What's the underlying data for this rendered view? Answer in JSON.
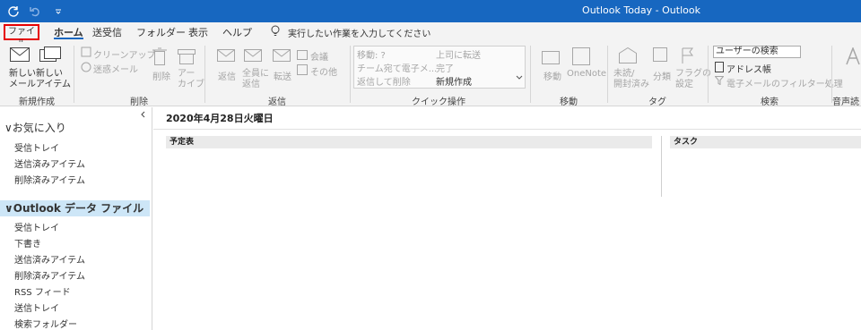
{
  "window": {
    "title": "Outlook Today  -  Outlook"
  },
  "quick_access": [
    "sync-icon",
    "undo-icon",
    "customize-icon"
  ],
  "menu": {
    "tabs": [
      "ファイル",
      "ホーム",
      "送受信",
      "フォルダー",
      "表示",
      "ヘルプ"
    ],
    "tell_me": "実行したい作業を入力してください",
    "active_tab": "ホーム",
    "highlight_color": "#e60000"
  },
  "ribbon": {
    "new_group": {
      "label": "新規作成",
      "new_mail": "新しい\nメール",
      "new_items": "新しい\nアイテム"
    },
    "delete_group": {
      "label": "削除",
      "cleanup": "クリーンアップ",
      "junk": "迷惑メール",
      "delete": "削除",
      "archive": "アー\nカイブ"
    },
    "respond_group": {
      "label": "返信",
      "reply": "返信",
      "reply_all": "全員に\n返信",
      "forward": "転送",
      "meeting": "会議",
      "more": "その他"
    },
    "quick_steps": {
      "label": "クイック操作",
      "items": [
        "移動: ?",
        "チーム宛て電子メ...",
        "返信して削除",
        "上司に転送",
        "完了",
        "新規作成"
      ]
    },
    "move_group": {
      "label": "移動",
      "move": "移動",
      "onenote": "OneNote"
    },
    "tags_group": {
      "label": "タグ",
      "unread": "未読/\n開封済み",
      "categorize": "分類",
      "flag": "フラグの\n設定"
    },
    "find_group": {
      "label": "検索",
      "search_placeholder": "ユーザーの検索",
      "address_book": "アドレス帳",
      "filter": "電子メールのフィルター処理"
    },
    "speech_group": {
      "label": "音声読"
    }
  },
  "nav": {
    "favorites": {
      "label": "お気に入り",
      "items": [
        "受信トレイ",
        "送信済みアイテム",
        "削除済みアイテム"
      ]
    },
    "data_file": {
      "label": "Outlook データ ファイル",
      "items": [
        "受信トレイ",
        "下書き",
        "送信済みアイテム",
        "削除済みアイテム",
        "RSS フィード",
        "送信トレイ",
        "検索フォルダー"
      ]
    }
  },
  "main": {
    "date": "2020年4月28日火曜日",
    "calendar_header": "予定表",
    "tasks_header": "タスク"
  },
  "colors": {
    "title_bar": "#1767c0",
    "ribbon_bg": "#f3f3f3",
    "nav_selected": "#cde6f7"
  }
}
